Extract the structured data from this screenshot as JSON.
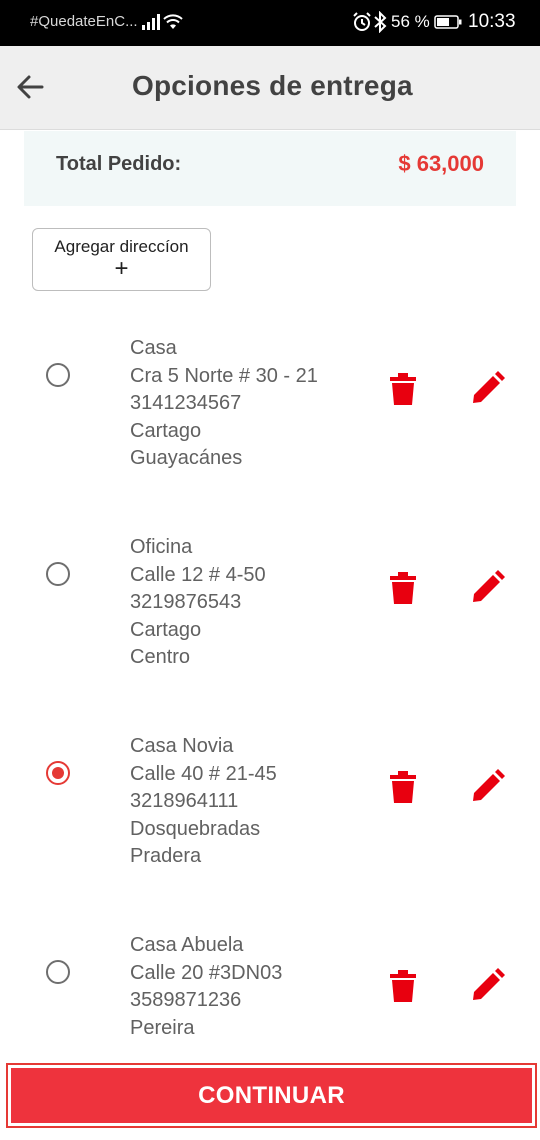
{
  "status_bar": {
    "carrier_text": "#QuedateEnC...",
    "battery_percent": "56 %",
    "time": "10:33",
    "icons": [
      "signal-icon",
      "wifi-icon",
      "alarm-icon",
      "bluetooth-icon",
      "battery-icon"
    ]
  },
  "header": {
    "title": "Opciones de entrega",
    "back_icon": "arrow-left-icon"
  },
  "order": {
    "total_label": "Total Pedido:",
    "total_value": "$ 63,000"
  },
  "add_address": {
    "label": "Agregar direccíon",
    "plus": "+"
  },
  "addresses": [
    {
      "name": "Casa",
      "street": "Cra 5 Norte # 30 - 21",
      "phone": "3141234567",
      "city": "Cartago",
      "neighborhood": "Guayacánes",
      "selected": false
    },
    {
      "name": "Oficina",
      "street": "Calle 12 # 4-50",
      "phone": "3219876543",
      "city": "Cartago",
      "neighborhood": "Centro",
      "selected": false
    },
    {
      "name": "Casa Novia",
      "street": "Calle 40 # 21-45",
      "phone": "3218964111",
      "city": "Dosquebradas",
      "neighborhood": "Pradera",
      "selected": true
    },
    {
      "name": "Casa Abuela",
      "street": "Calle 20 #3DN03",
      "phone": "3589871236",
      "city": "Pereira",
      "neighborhood": "",
      "selected": false
    }
  ],
  "actions": {
    "delete_icon": "trash-icon",
    "edit_icon": "pencil-icon"
  },
  "continue_label": "CONTINUAR",
  "colors": {
    "accent": "#e53935",
    "button": "#ee333d",
    "total_bg": "#f2f8f8",
    "appbar_bg": "#efefef"
  }
}
